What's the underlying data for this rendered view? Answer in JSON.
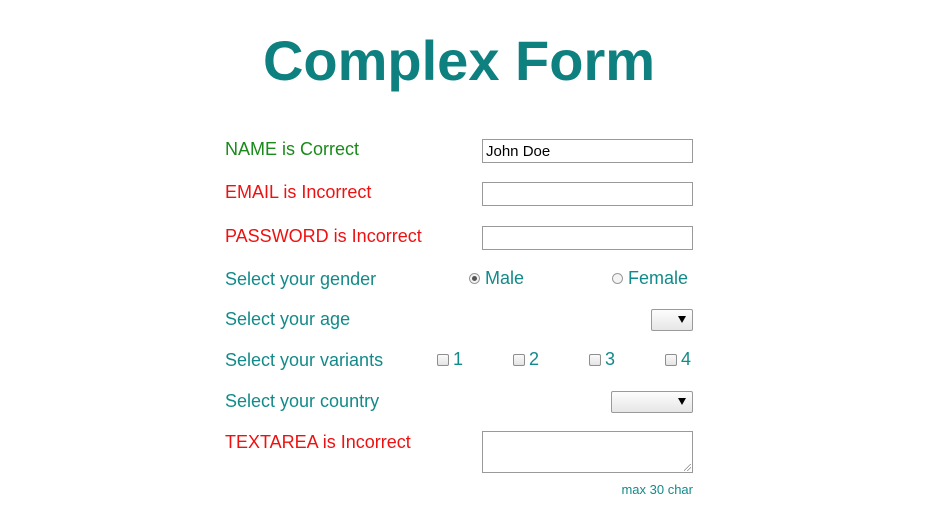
{
  "title": "Complex Form",
  "fields": {
    "name": {
      "label": "NAME is Correct",
      "value": "John Doe"
    },
    "email": {
      "label": "EMAIL is Incorrect",
      "value": ""
    },
    "password": {
      "label": "PASSWORD is Incorrect",
      "value": ""
    },
    "gender": {
      "label": "Select your gender",
      "options": [
        "Male",
        "Female"
      ],
      "selected": "Male"
    },
    "age": {
      "label": "Select your age",
      "value": ""
    },
    "variants": {
      "label": "Select your variants",
      "options": [
        "1",
        "2",
        "3",
        "4"
      ]
    },
    "country": {
      "label": "Select your country",
      "value": ""
    },
    "textarea": {
      "label": "TEXTAREA is Incorrect",
      "value": "",
      "hint": "max 30 char"
    }
  },
  "colors": {
    "title": "#0e8080",
    "label": "#138a8a",
    "valid": "#1a8a1a",
    "invalid": "#ee1111"
  },
  "icons": {
    "select_arrow": "chevron-down-icon",
    "textarea_resize": "resize-grip-icon"
  }
}
